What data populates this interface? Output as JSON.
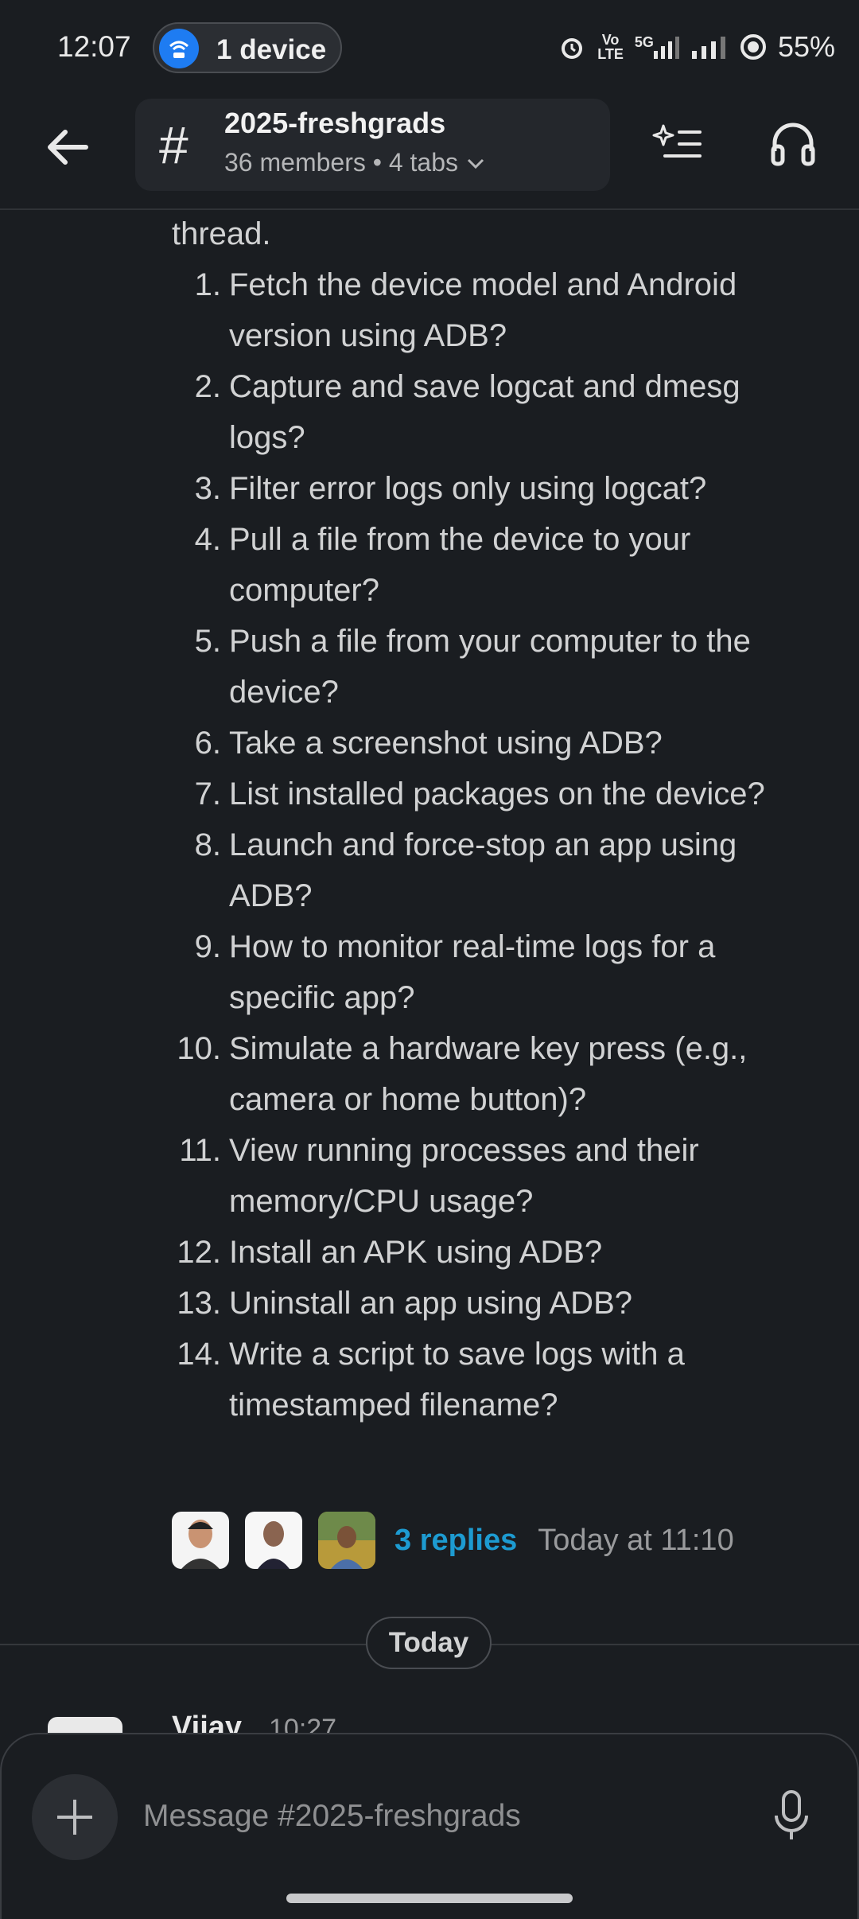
{
  "status_bar": {
    "time": "12:07",
    "device_label": "1 device",
    "net_top": "Vo",
    "net_bottom": "LTE",
    "net_5g": "5G",
    "battery": "55%"
  },
  "header": {
    "channel_name": "2025-freshgrads",
    "channel_meta": "36 members • 4 tabs"
  },
  "message": {
    "lead": "thread.",
    "items": [
      {
        "num": "1.",
        "text": "Fetch the device model and Android version using ADB?"
      },
      {
        "num": "2.",
        "text": "Capture and save logcat and dmesg logs?"
      },
      {
        "num": "3.",
        "text": "Filter error logs only using logcat?"
      },
      {
        "num": "4.",
        "text": "Pull a file from the device to your computer?"
      },
      {
        "num": "5.",
        "text": "Push a file from your computer to the device?"
      },
      {
        "num": "6.",
        "text": "Take a screenshot using ADB?"
      },
      {
        "num": "7.",
        "text": "List installed packages on the device?"
      },
      {
        "num": "8.",
        "text": "Launch and force-stop an app using ADB?"
      },
      {
        "num": "9.",
        "text": "How to monitor real-time logs for a specific app?"
      },
      {
        "num": "10.",
        "text": "Simulate a hardware key press (e.g., camera or home button)?"
      },
      {
        "num": "11.",
        "text": "View running processes and their memory/CPU usage?"
      },
      {
        "num": "12.",
        "text": "Install an APK using ADB?"
      },
      {
        "num": "13.",
        "text": "Uninstall an app using ADB?"
      },
      {
        "num": "14.",
        "text": "Write a script to save logs with a timestamped filename?"
      }
    ],
    "replies_label": "3 replies",
    "replies_time": "Today at 11:10"
  },
  "date_divider": "Today",
  "next_message": {
    "author": "Vijay",
    "time": "10:27"
  },
  "composer": {
    "placeholder": "Message #2025-freshgrads"
  },
  "colors": {
    "background": "#1a1d21",
    "link": "#1d9bd1",
    "device_pill_icon": "#1e7cf2"
  },
  "icons": {
    "back": "arrow-left-icon",
    "channel": "hash-icon",
    "ai": "sparkle-list-icon",
    "huddle": "headphones-icon",
    "add": "plus-icon",
    "mic": "microphone-icon",
    "alarm": "alarm-icon",
    "battery": "battery-saver-icon"
  }
}
